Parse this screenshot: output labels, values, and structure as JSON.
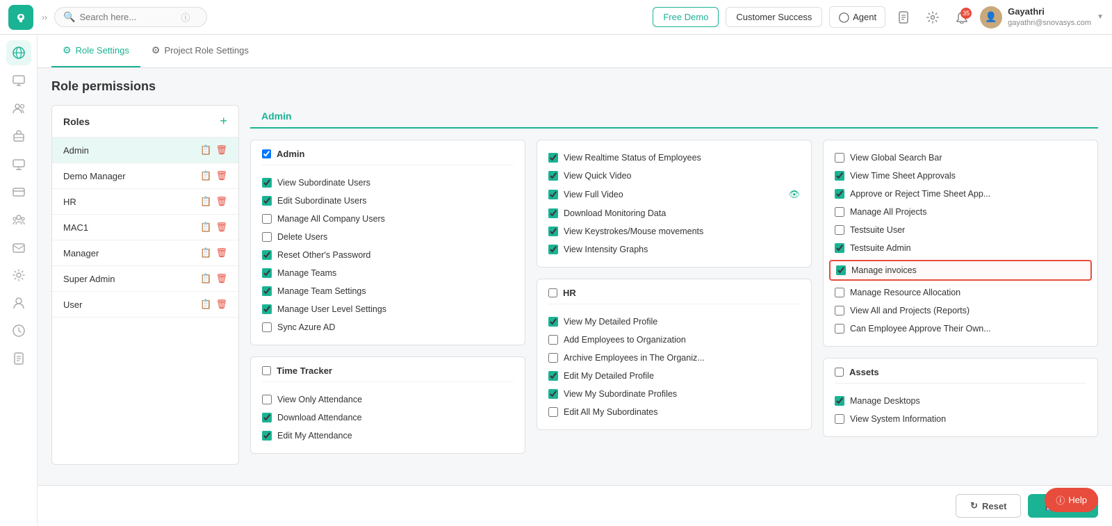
{
  "app": {
    "logo": "S",
    "search_placeholder": "Search here...",
    "free_demo_label": "Free Demo",
    "customer_success_label": "Customer Success",
    "agent_label": "Agent",
    "notification_count": "35",
    "user_name": "Gayathri",
    "user_email": "gayathri@snovasys.com"
  },
  "tabs": {
    "role_settings": "Role Settings",
    "project_role_settings": "Project Role Settings"
  },
  "page": {
    "title": "Role permissions"
  },
  "roles_panel": {
    "title": "Roles",
    "add_label": "+",
    "items": [
      {
        "name": "Admin",
        "active": true
      },
      {
        "name": "Demo Manager",
        "active": false
      },
      {
        "name": "HR",
        "active": false
      },
      {
        "name": "MAC1",
        "active": false
      },
      {
        "name": "Manager",
        "active": false
      },
      {
        "name": "Super Admin",
        "active": false
      },
      {
        "name": "User",
        "active": false
      }
    ]
  },
  "permissions": {
    "selected_role": "Admin",
    "column1": {
      "groups": [
        {
          "id": "admin-general",
          "header_checkbox": true,
          "header_label": "Admin",
          "items": [
            {
              "label": "View Subordinate Users",
              "checked": true
            },
            {
              "label": "Edit Subordinate Users",
              "checked": true
            },
            {
              "label": "Manage All Company Users",
              "checked": false
            },
            {
              "label": "Delete Users",
              "checked": false
            },
            {
              "label": "Reset Other's Password",
              "checked": true
            },
            {
              "label": "Manage Teams",
              "checked": true
            },
            {
              "label": "Manage Team Settings",
              "checked": true
            },
            {
              "label": "Manage User Level Settings",
              "checked": true
            },
            {
              "label": "Sync Azure AD",
              "checked": false
            }
          ]
        },
        {
          "id": "time-tracker",
          "header_checkbox": false,
          "header_label": "Time Tracker",
          "items": [
            {
              "label": "View Only Attendance",
              "checked": false
            },
            {
              "label": "Download Attendance",
              "checked": true
            },
            {
              "label": "Edit My Attendance",
              "checked": true
            }
          ]
        }
      ]
    },
    "column2": {
      "groups": [
        {
          "id": "monitoring",
          "header_checkbox": true,
          "header_label": "",
          "items": [
            {
              "label": "View Realtime Status of Employees",
              "checked": true
            },
            {
              "label": "View Quick Video",
              "checked": true
            },
            {
              "label": "View Full Video",
              "checked": true,
              "has_eye": true
            },
            {
              "label": "Download Monitoring Data",
              "checked": true
            },
            {
              "label": "View Keystrokes/Mouse movements",
              "checked": true
            },
            {
              "label": "View Intensity Graphs",
              "checked": true
            }
          ]
        },
        {
          "id": "hr-group",
          "header_checkbox": false,
          "header_label": "HR",
          "items": [
            {
              "label": "View My Detailed Profile",
              "checked": true
            },
            {
              "label": "Add Employees to Organization",
              "checked": false
            },
            {
              "label": "Archive Employees in The Organiz...",
              "checked": false
            },
            {
              "label": "Edit My Detailed Profile",
              "checked": true
            },
            {
              "label": "View My Subordinate Profiles",
              "checked": true
            },
            {
              "label": "Edit All My Subordinates",
              "checked": false
            }
          ]
        }
      ]
    },
    "column3": {
      "groups": [
        {
          "id": "misc-top",
          "header_checkbox": false,
          "header_label": "",
          "highlighted": false,
          "items": [
            {
              "label": "View Global Search Bar",
              "checked": false
            },
            {
              "label": "View Time Sheet Approvals",
              "checked": true
            },
            {
              "label": "Approve or Reject Time Sheet App...",
              "checked": true
            },
            {
              "label": "Manage All Projects",
              "checked": false
            },
            {
              "label": "Testsuite User",
              "checked": false
            },
            {
              "label": "Testsuite Admin",
              "checked": true
            },
            {
              "label": "Manage invoices",
              "checked": true,
              "highlighted": true
            },
            {
              "label": "Manage Resource Allocation",
              "checked": false
            },
            {
              "label": "View All and Projects (Reports)",
              "checked": false
            },
            {
              "label": "Can Employee Approve Their Own...",
              "checked": false
            }
          ]
        },
        {
          "id": "assets",
          "header_checkbox": false,
          "header_label": "Assets",
          "items": [
            {
              "label": "Manage Desktops",
              "checked": true
            },
            {
              "label": "View System Information",
              "checked": false
            }
          ]
        }
      ]
    }
  },
  "footer": {
    "save_label": "Save",
    "reset_label": "Reset"
  },
  "help": {
    "label": "Help"
  }
}
